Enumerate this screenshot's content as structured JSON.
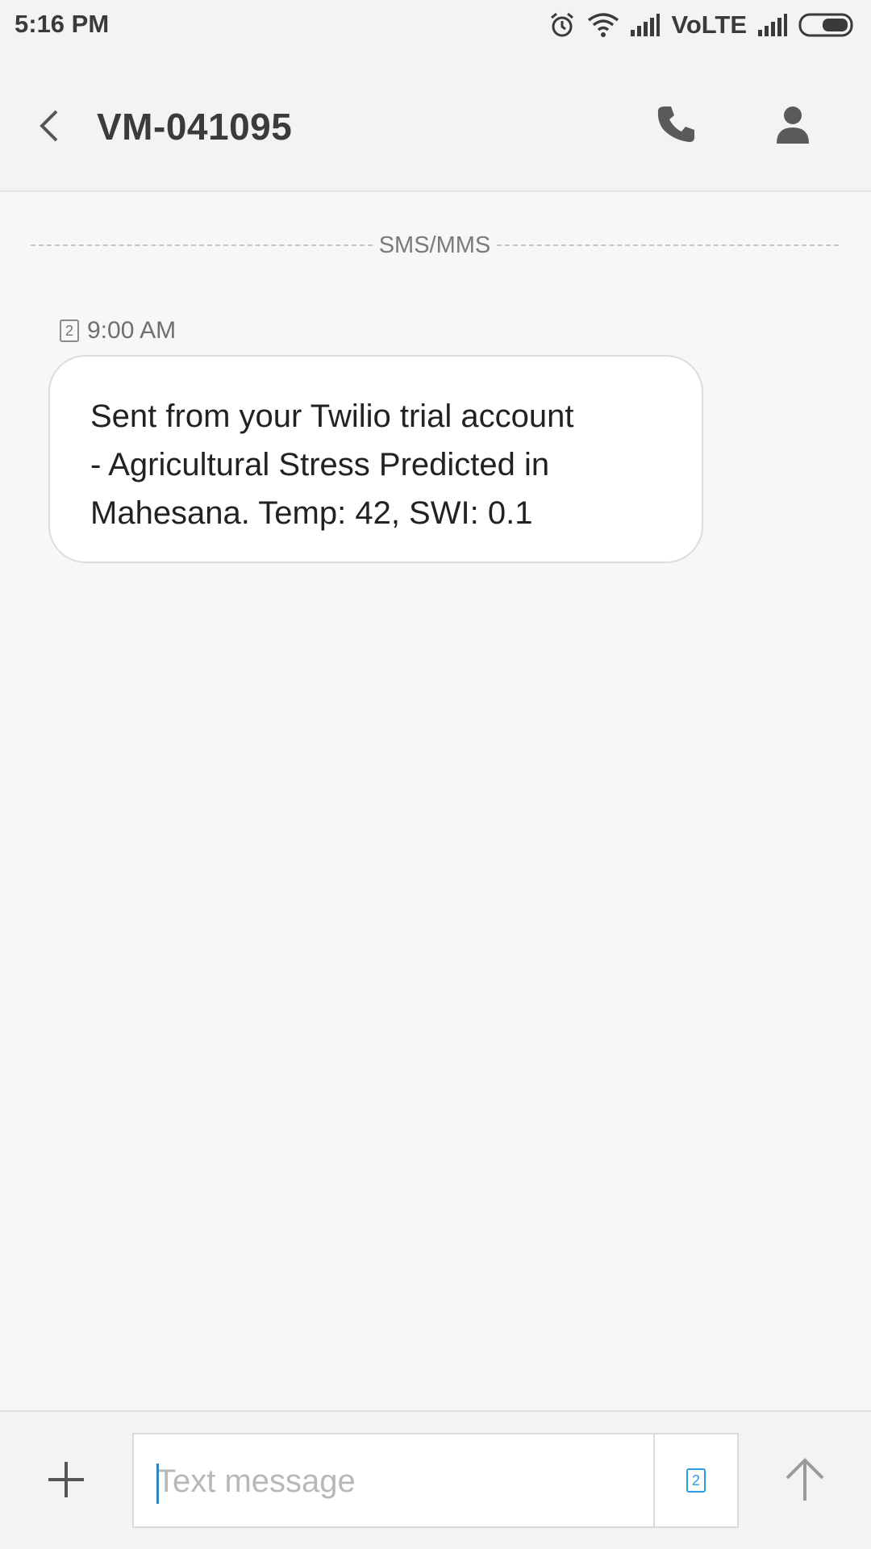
{
  "status_bar": {
    "time": "5:16 PM",
    "network_label": "VoLTE",
    "icons": [
      "alarm-icon",
      "wifi-icon",
      "signal-icon",
      "signal-icon",
      "battery-icon"
    ]
  },
  "header": {
    "title": "VM-041095",
    "icons": [
      "back-arrow-icon",
      "phone-icon",
      "person-icon"
    ]
  },
  "thread": {
    "divider_label": "SMS/MMS",
    "messages": [
      {
        "sim": "2",
        "time": "9:00 AM",
        "text": "Sent from your Twilio trial account\n- Agricultural Stress Predicted in\nMahesana. Temp: 42, SWI: 0.1"
      }
    ]
  },
  "composer": {
    "placeholder": "Text message",
    "sim": "2",
    "icons": [
      "plus-icon",
      "sim-card-icon",
      "send-arrow-icon"
    ]
  },
  "colors": {
    "accent": "#2d9be6",
    "background": "#f7f7f7",
    "bar": "#f2f3f3"
  }
}
